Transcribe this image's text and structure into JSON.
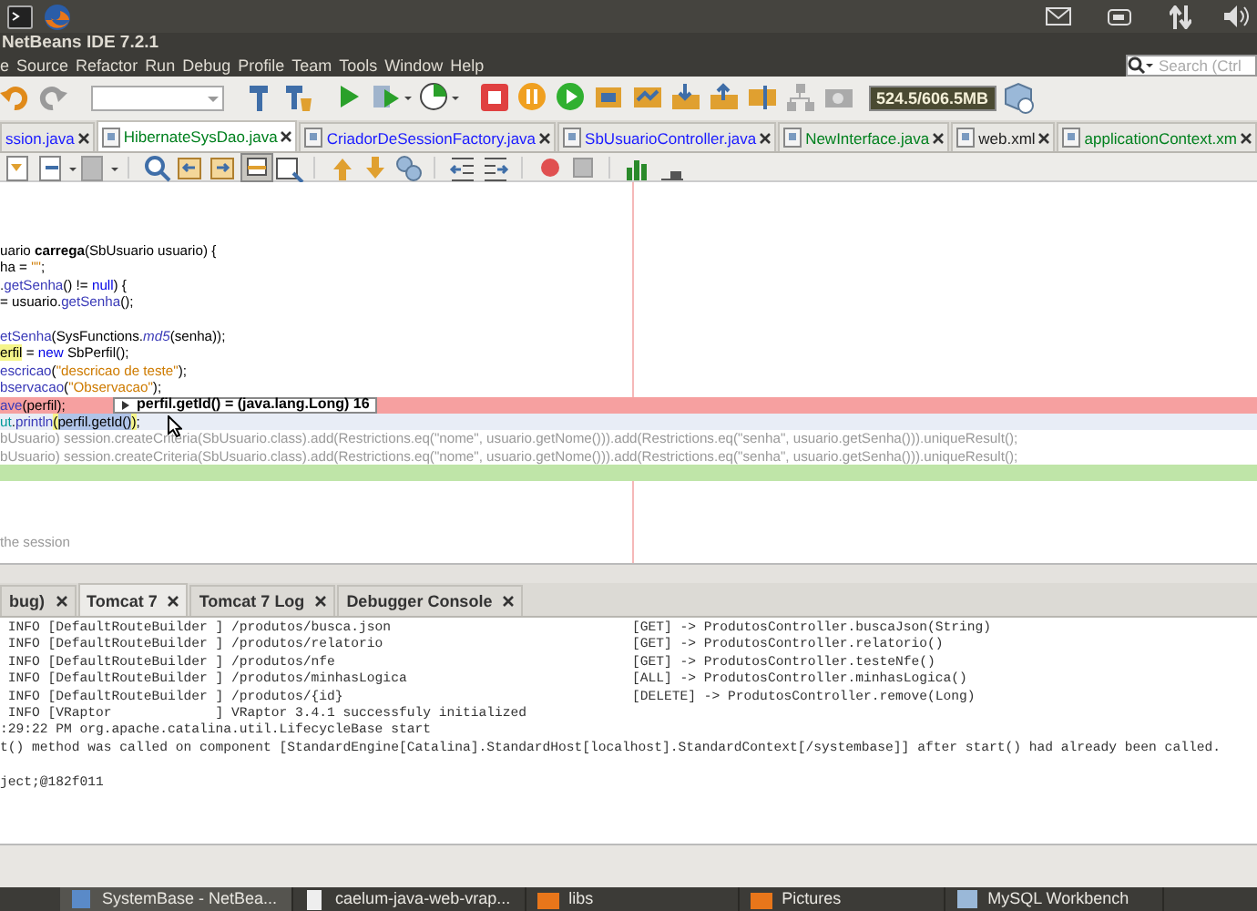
{
  "window": {
    "title": "NetBeans IDE 7.2.1"
  },
  "menu": [
    "e",
    "Source",
    "Refactor",
    "Run",
    "Debug",
    "Profile",
    "Team",
    "Tools",
    "Window",
    "Help"
  ],
  "search": {
    "placeholder": "Search (Ctrl"
  },
  "memory": {
    "text": "524.5/606.5MB"
  },
  "editor_tabs": [
    {
      "label": "ssion.java",
      "color": "#1a1aff",
      "selected": false
    },
    {
      "label": "HibernateSysDao.java",
      "color": "#00801e",
      "selected": true
    },
    {
      "label": "CriadorDeSessionFactory.java",
      "color": "#1a1aff",
      "selected": false
    },
    {
      "label": "SbUsuarioController.java",
      "color": "#1a1aff",
      "selected": false
    },
    {
      "label": "NewInterface.java",
      "color": "#00801e",
      "selected": false
    },
    {
      "label": "web.xml",
      "color": "#222222",
      "selected": false
    },
    {
      "label": "applicationContext.xm",
      "color": "#00801e",
      "selected": false
    }
  ],
  "code_lines": [
    {
      "kind": "code",
      "tokens": [
        {
          "kind": "plain",
          "text": "uario "
        },
        {
          "kind": "decl",
          "text": "carrega"
        },
        {
          "kind": "plain",
          "text": "(SbUsuario usuario) {"
        }
      ]
    },
    {
      "kind": "code",
      "tokens": [
        {
          "kind": "plain",
          "text": "ha = "
        },
        {
          "kind": "string",
          "text": "\"\""
        },
        {
          "kind": "plain",
          "text": ";"
        }
      ]
    },
    {
      "kind": "code",
      "tokens": [
        {
          "kind": "plain",
          "text": "."
        },
        {
          "kind": "method",
          "text": "getSenha"
        },
        {
          "kind": "plain",
          "text": "() != "
        },
        {
          "kind": "keyword",
          "text": "null"
        },
        {
          "kind": "plain",
          "text": ") {"
        }
      ]
    },
    {
      "kind": "code",
      "tokens": [
        {
          "kind": "plain",
          "text": "= usuario."
        },
        {
          "kind": "method",
          "text": "getSenha"
        },
        {
          "kind": "plain",
          "text": "();"
        }
      ]
    },
    {
      "kind": "blank"
    },
    {
      "kind": "code",
      "tokens": [
        {
          "kind": "method",
          "text": "etSenha"
        },
        {
          "kind": "plain",
          "text": "(SysFunctions."
        },
        {
          "kind": "static",
          "text": "md5"
        },
        {
          "kind": "plain",
          "text": "(senha));"
        }
      ]
    },
    {
      "kind": "code",
      "tokens": [
        {
          "kind": "mark",
          "text": "erfil"
        },
        {
          "kind": "plain",
          "text": " = "
        },
        {
          "kind": "keyword",
          "text": "new"
        },
        {
          "kind": "plain",
          "text": " SbPerfil();"
        }
      ]
    },
    {
      "kind": "code",
      "tokens": [
        {
          "kind": "method",
          "text": "escricao"
        },
        {
          "kind": "plain",
          "text": "("
        },
        {
          "kind": "string",
          "text": "\"descricao de teste\""
        },
        {
          "kind": "plain",
          "text": ");"
        }
      ]
    },
    {
      "kind": "code",
      "tokens": [
        {
          "kind": "method",
          "text": "bservacao"
        },
        {
          "kind": "plain",
          "text": "("
        },
        {
          "kind": "string",
          "text": "\"Observacao\""
        },
        {
          "kind": "plain",
          "text": ");"
        }
      ]
    },
    {
      "kind": "breakpoint",
      "tokens": [
        {
          "kind": "method",
          "text": "ave"
        },
        {
          "kind": "plain",
          "text": "(perfil);"
        }
      ]
    },
    {
      "kind": "current",
      "tokens": [
        {
          "kind": "field",
          "text": "ut"
        },
        {
          "kind": "plain",
          "text": "."
        },
        {
          "kind": "method",
          "text": "println"
        },
        {
          "kind": "mark",
          "text": "("
        },
        {
          "kind": "selected",
          "text": "perfil.getId()"
        },
        {
          "kind": "mark",
          "text": ")"
        },
        {
          "kind": "plain",
          "text": ";"
        }
      ]
    },
    {
      "kind": "code",
      "tokens": [
        {
          "kind": "dim",
          "text": "bUsuario) session.createCriteria(SbUsuario.class).add(Restrictions.eq(\"nome\", usuario.getNome())).add(Restrictions.eq(\"senha\", usuario.getSenha())).uniqueResult();"
        }
      ]
    },
    {
      "kind": "code",
      "tokens": [
        {
          "kind": "dim",
          "text": "bUsuario) session.createCriteria(SbUsuario.class).add(Restrictions.eq(\"nome\", usuario.getNome())).add(Restrictions.eq(\"senha\", usuario.getSenha())).uniqueResult();"
        }
      ]
    },
    {
      "kind": "added"
    },
    {
      "kind": "blank"
    },
    {
      "kind": "blank"
    },
    {
      "kind": "blank"
    },
    {
      "kind": "code",
      "tokens": [
        {
          "kind": "dim",
          "text": "the session"
        }
      ]
    }
  ],
  "tooltip": {
    "text": "perfil.getId() = (java.lang.Long) 16"
  },
  "output_tabs": [
    {
      "label": "bug)",
      "selected": false
    },
    {
      "label": "Tomcat 7",
      "selected": true
    },
    {
      "label": "Tomcat 7 Log",
      "selected": false
    },
    {
      "label": "Debugger Console",
      "selected": false
    }
  ],
  "output_lines": [
    {
      "text": " INFO [DefaultRouteBuilder ] /produtos/busca.json",
      "route": "[GET] -> ProdutosController.buscaJson(String)"
    },
    {
      "text": " INFO [DefaultRouteBuilder ] /produtos/relatorio",
      "route": "[GET] -> ProdutosController.relatorio()"
    },
    {
      "text": " INFO [DefaultRouteBuilder ] /produtos/nfe",
      "route": "[GET] -> ProdutosController.testeNfe()"
    },
    {
      "text": " INFO [DefaultRouteBuilder ] /produtos/minhasLogica",
      "route": "[ALL] -> ProdutosController.minhasLogica()"
    },
    {
      "text": " INFO [DefaultRouteBuilder ] /produtos/{id}",
      "route": "[DELETE] -> ProdutosController.remove(Long)"
    },
    {
      "text": " INFO [VRaptor             ] VRaptor 3.4.1 successfuly initialized"
    },
    {
      "text": ":29:22 PM org.apache.catalina.util.LifecycleBase start"
    },
    {
      "text": "t() method was called on component [StandardEngine[Catalina].StandardHost[localhost].StandardContext[/systembase]] after start() had already been called."
    },
    {
      "text": "ject;@182f011"
    }
  ],
  "taskbar": [
    {
      "label": "SystemBase - NetBea...",
      "selected": true
    },
    {
      "label": "caelum-java-web-vrap...",
      "selected": false
    },
    {
      "label": "libs",
      "selected": false
    },
    {
      "label": "Pictures",
      "selected": false
    },
    {
      "label": "MySQL Workbench",
      "selected": false
    }
  ]
}
